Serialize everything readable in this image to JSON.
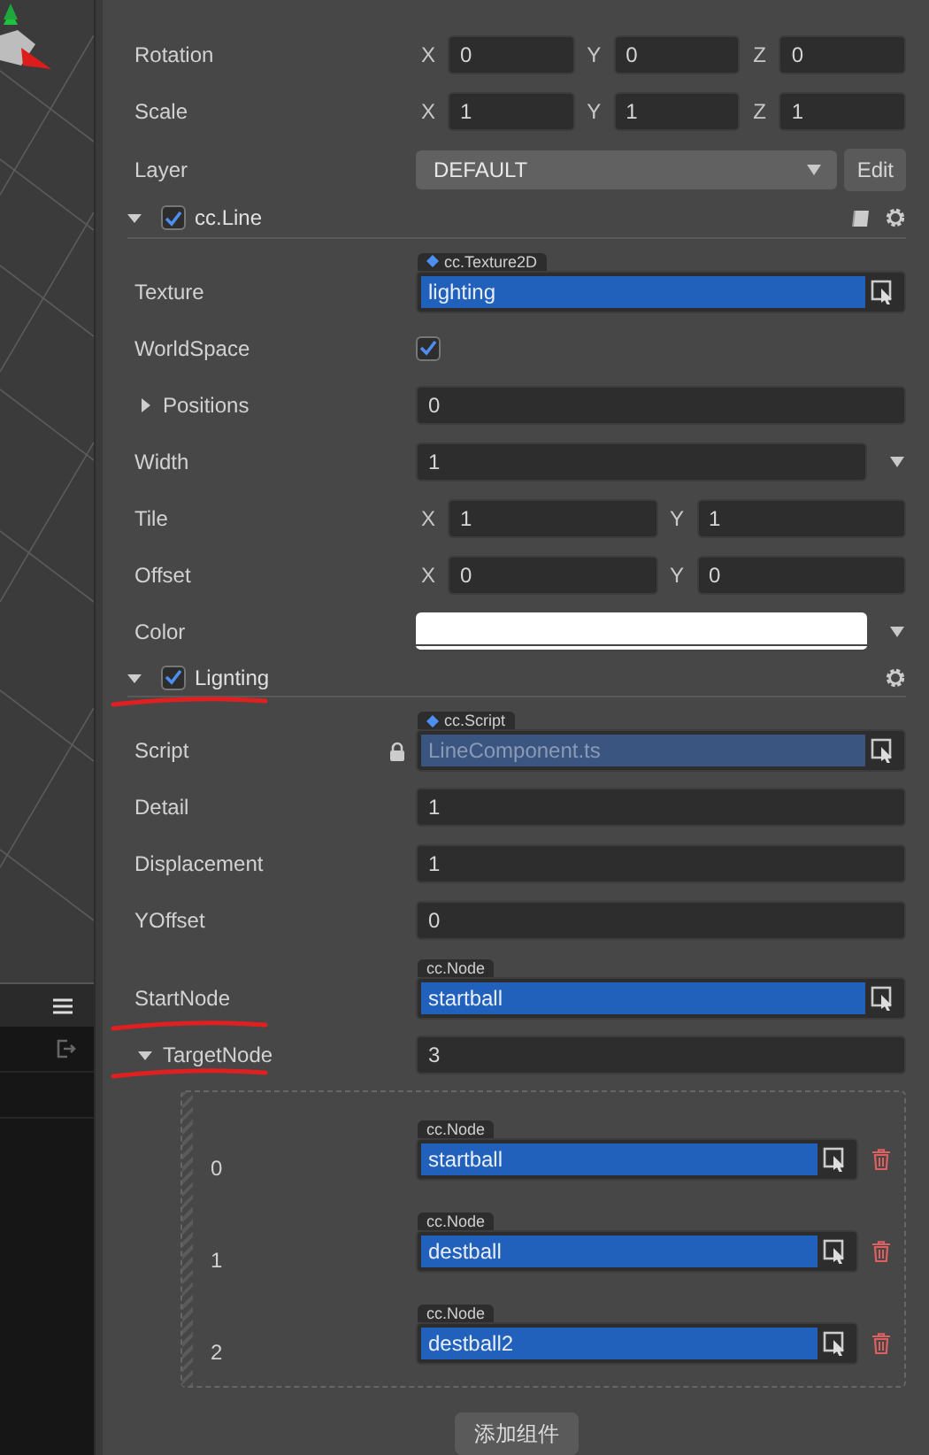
{
  "transform": [
    {
      "kind": "vector",
      "label": "Rotation",
      "axes": [
        {
          "axis": "X",
          "value": "0"
        },
        {
          "axis": "Y",
          "value": "0"
        },
        {
          "axis": "Z",
          "value": "0"
        }
      ]
    },
    {
      "kind": "vector",
      "label": "Scale",
      "axes": [
        {
          "axis": "X",
          "value": "1"
        },
        {
          "axis": "Y",
          "value": "1"
        },
        {
          "axis": "Z",
          "value": "1"
        }
      ]
    },
    {
      "kind": "select",
      "label": "Layer",
      "value": "DEFAULT",
      "button": "Edit"
    }
  ],
  "components": [
    {
      "name": "cc.Line",
      "enabled": true,
      "expanded": true,
      "help_icon": true,
      "properties": [
        {
          "kind": "object",
          "label": "Texture",
          "type": "cc.Texture2D",
          "asset": true,
          "value": "lighting"
        },
        {
          "kind": "checkbox",
          "label": "WorldSpace",
          "checked": true
        },
        {
          "kind": "array",
          "label": "Positions",
          "expanded": false,
          "value": "0"
        },
        {
          "kind": "number",
          "label": "Width",
          "value": "1",
          "dropdown": true
        },
        {
          "kind": "vector",
          "label": "Tile",
          "axes": [
            {
              "axis": "X",
              "value": "1"
            },
            {
              "axis": "Y",
              "value": "1"
            }
          ]
        },
        {
          "kind": "vector",
          "label": "Offset",
          "axes": [
            {
              "axis": "X",
              "value": "0"
            },
            {
              "axis": "Y",
              "value": "0"
            }
          ]
        },
        {
          "kind": "color",
          "label": "Color",
          "color": "#ffffff",
          "dropdown": true
        }
      ]
    },
    {
      "name": "Lignting",
      "enabled": true,
      "expanded": true,
      "annotated": true,
      "properties": [
        {
          "kind": "object",
          "label": "Script",
          "type": "cc.Script",
          "asset": true,
          "value": "LineComponent.ts",
          "locked": true
        },
        {
          "kind": "number",
          "label": "Detail",
          "value": "1"
        },
        {
          "kind": "number",
          "label": "Displacement",
          "value": "1"
        },
        {
          "kind": "number",
          "label": "YOffset",
          "value": "0"
        },
        {
          "kind": "object",
          "label": "StartNode",
          "type": "cc.Node",
          "value": "startball",
          "annotated": true
        },
        {
          "kind": "array",
          "label": "TargetNode",
          "expanded": true,
          "value": "3",
          "annotated": true,
          "items": [
            {
              "index": "0",
              "type": "cc.Node",
              "value": "startball"
            },
            {
              "index": "1",
              "type": "cc.Node",
              "value": "destball"
            },
            {
              "index": "2",
              "type": "cc.Node",
              "value": "destball2"
            }
          ]
        }
      ]
    }
  ],
  "add_component_button": "添加组件"
}
